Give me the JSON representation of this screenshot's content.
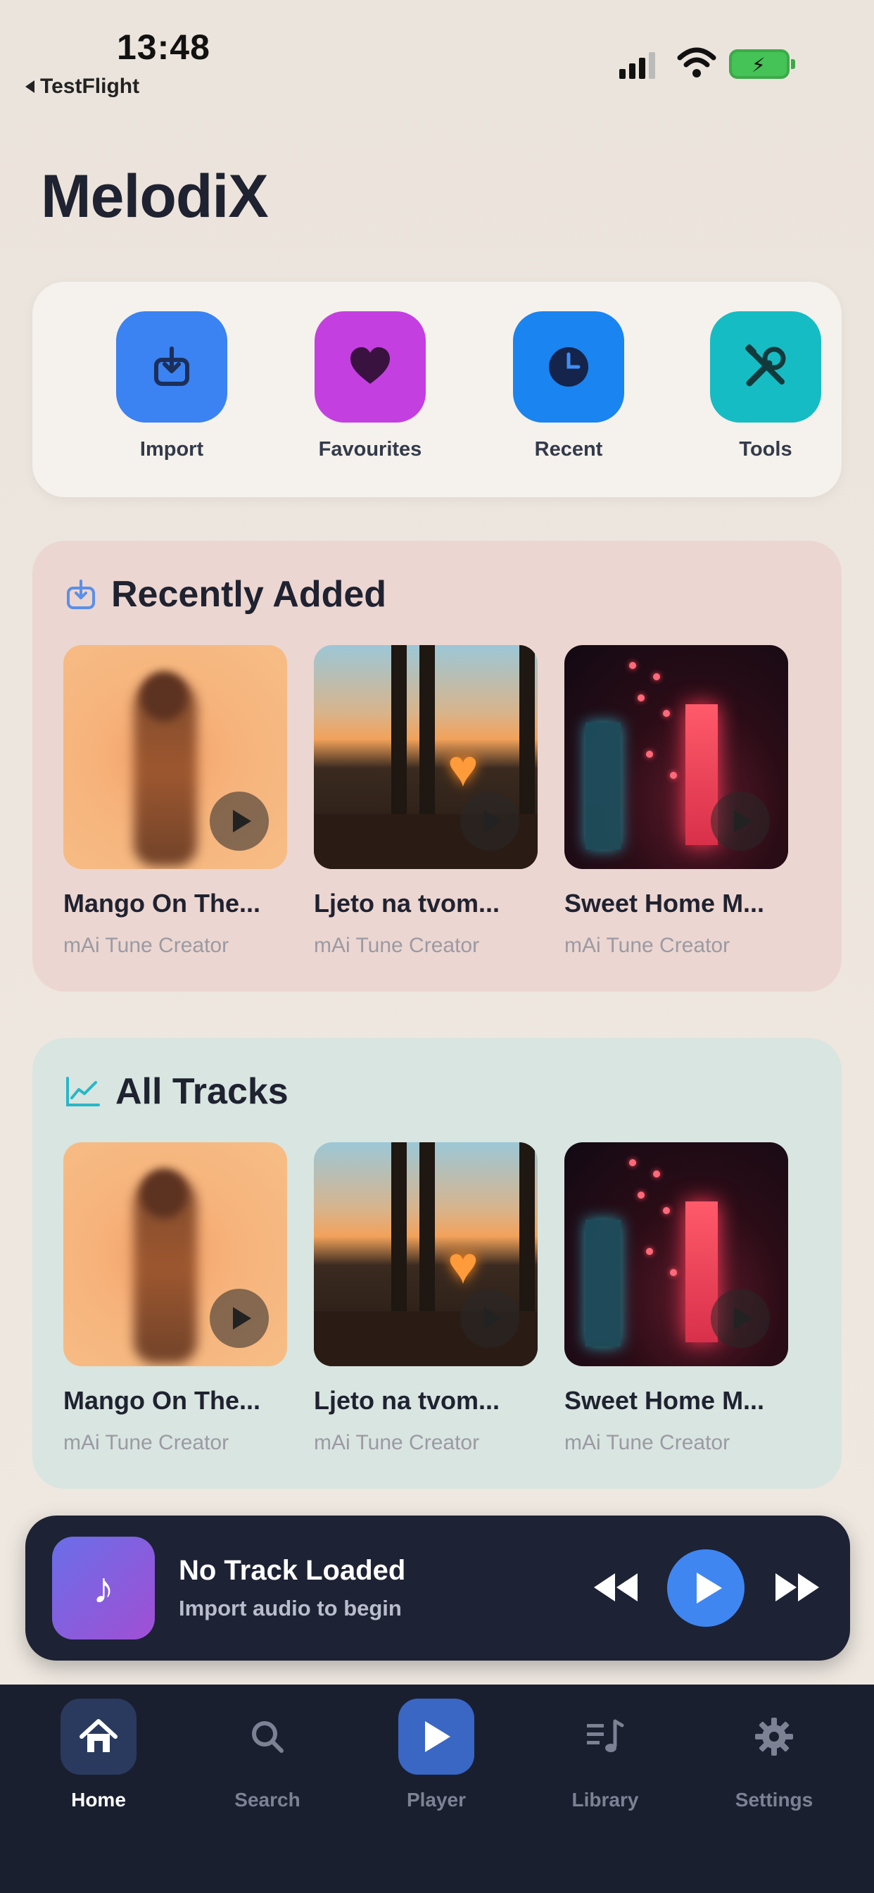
{
  "status_bar": {
    "time": "13:48",
    "back_app": "TestFlight"
  },
  "app": {
    "title": "MelodiX"
  },
  "quick_actions": [
    {
      "label": "Import",
      "icon": "import-icon",
      "color": "#3b82f2"
    },
    {
      "label": "Favourites",
      "icon": "heart-icon",
      "color": "#c43fe0"
    },
    {
      "label": "Recent",
      "icon": "clock-icon",
      "color": "#1a84f0"
    },
    {
      "label": "Tools",
      "icon": "tools-icon",
      "color": "#16bcc4"
    }
  ],
  "recently_added": {
    "title": "Recently Added",
    "icon": "import-icon",
    "tracks": [
      {
        "title": "Mango On The...",
        "artist": "mAi Tune Creator"
      },
      {
        "title": "Ljeto na tvom...",
        "artist": "mAi Tune Creator"
      },
      {
        "title": "Sweet Home M...",
        "artist": "mAi Tune Creator"
      }
    ]
  },
  "all_tracks": {
    "title": "All Tracks",
    "icon": "chart-icon",
    "tracks": [
      {
        "title": "Mango On The...",
        "artist": "mAi Tune Creator"
      },
      {
        "title": "Ljeto na tvom...",
        "artist": "mAi Tune Creator"
      },
      {
        "title": "Sweet Home M...",
        "artist": "mAi Tune Creator"
      }
    ]
  },
  "mini_player": {
    "title": "No Track Loaded",
    "subtitle": "Import audio to begin"
  },
  "tabs": [
    {
      "label": "Home",
      "icon": "home-icon",
      "active": true
    },
    {
      "label": "Search",
      "icon": "search-icon",
      "active": false
    },
    {
      "label": "Player",
      "icon": "play-icon",
      "active": false
    },
    {
      "label": "Library",
      "icon": "library-icon",
      "active": false
    },
    {
      "label": "Settings",
      "icon": "gear-icon",
      "active": false
    }
  ]
}
